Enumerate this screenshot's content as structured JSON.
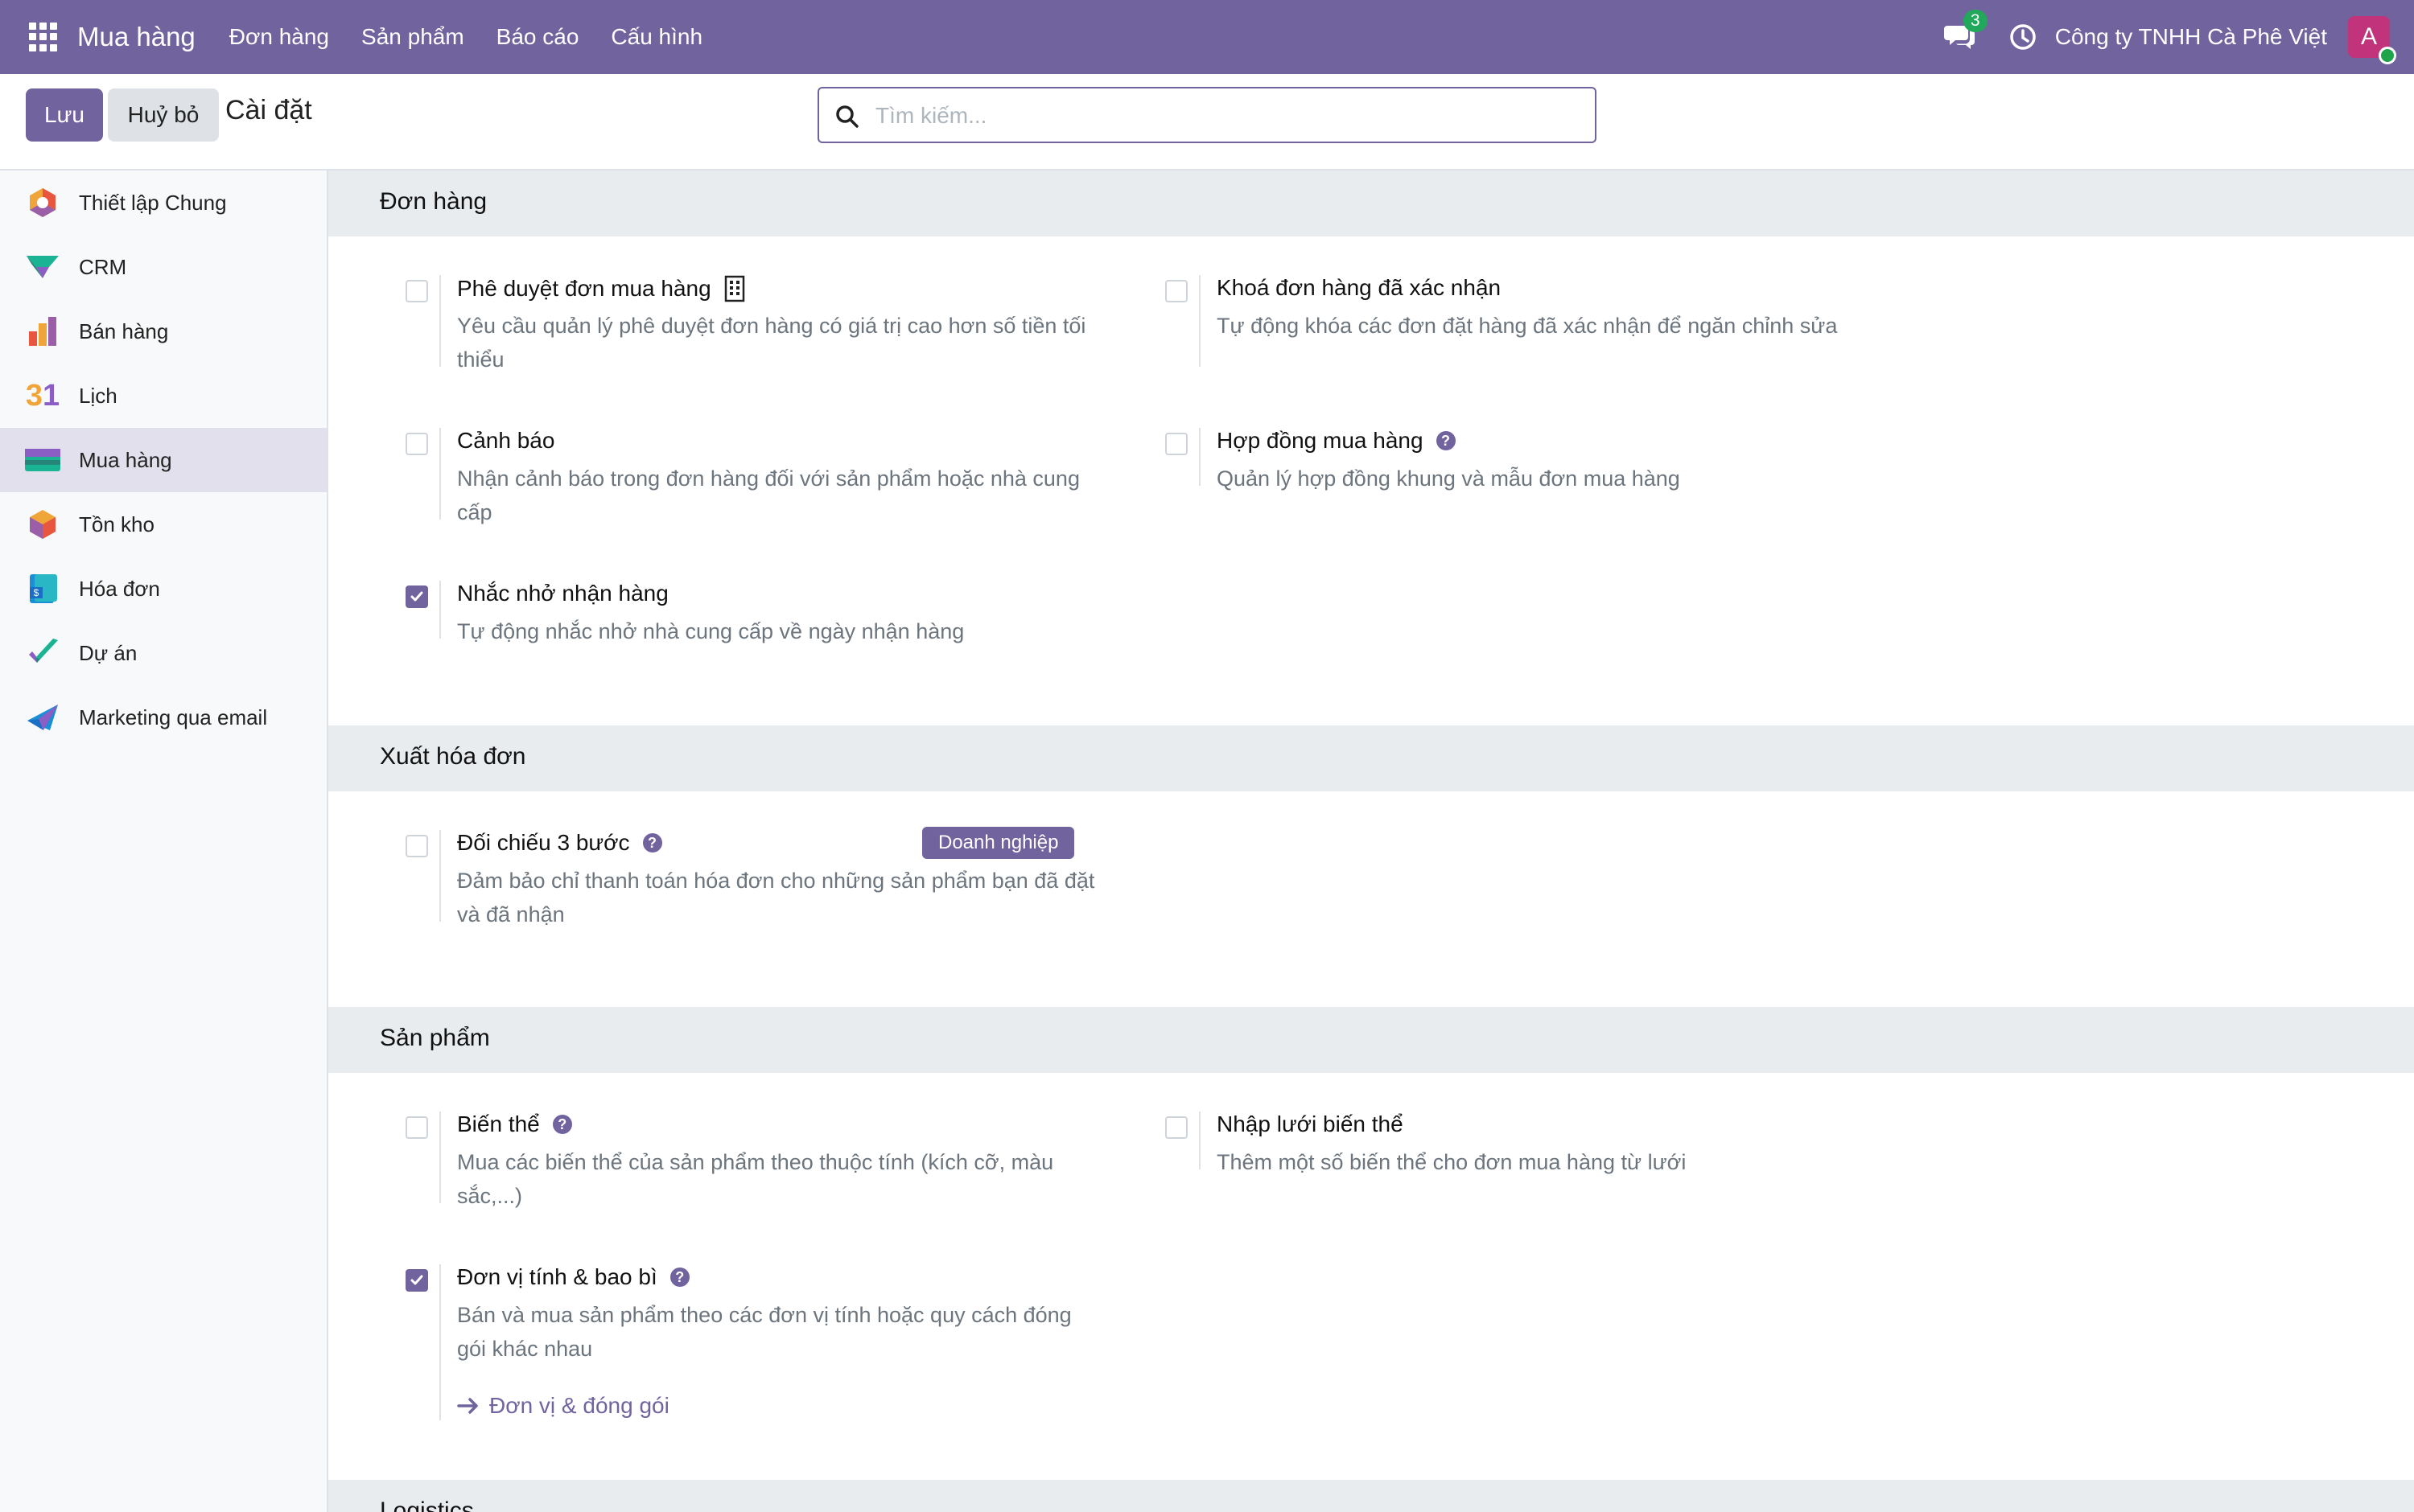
{
  "navbar": {
    "brand": "Mua hàng",
    "menu": [
      "Đơn hàng",
      "Sản phẩm",
      "Báo cáo",
      "Cấu hình"
    ],
    "messages_count": "3",
    "company": "Công ty TNHH Cà Phê Việt",
    "avatar_letter": "A"
  },
  "control": {
    "save_label": "Lưu",
    "discard_label": "Huỷ bỏ",
    "breadcrumb": "Cài đặt",
    "search_placeholder": "Tìm kiếm..."
  },
  "sidebar": {
    "items": [
      {
        "label": "Thiết lập Chung",
        "icon": "settings-app-icon",
        "active": false
      },
      {
        "label": "CRM",
        "icon": "crm-app-icon",
        "active": false
      },
      {
        "label": "Bán hàng",
        "icon": "sales-app-icon",
        "active": false
      },
      {
        "label": "Lịch",
        "icon": "calendar-app-icon",
        "calendar_number": "31",
        "active": false
      },
      {
        "label": "Mua hàng",
        "icon": "purchase-app-icon",
        "active": true
      },
      {
        "label": "Tồn kho",
        "icon": "inventory-app-icon",
        "active": false
      },
      {
        "label": "Hóa đơn",
        "icon": "invoicing-app-icon",
        "active": false
      },
      {
        "label": "Dự án",
        "icon": "project-app-icon",
        "active": false
      },
      {
        "label": "Marketing qua email",
        "icon": "email-marketing-app-icon",
        "active": false
      }
    ]
  },
  "sections": {
    "orders": {
      "title": "Đơn hàng",
      "settings": [
        {
          "title": "Phê duyệt đơn mua hàng",
          "desc": "Yêu cầu quản lý phê duyệt đơn hàng có giá trị cao hơn số tiền tối thiểu",
          "checked": false,
          "icon": "company-building-icon"
        },
        {
          "title": "Khoá đơn hàng đã xác nhận",
          "desc": "Tự động khóa các đơn đặt hàng đã xác nhận để ngăn chỉnh sửa",
          "checked": false
        },
        {
          "title": "Cảnh báo",
          "desc": "Nhận cảnh báo trong đơn hàng đối với sản phẩm hoặc nhà cung cấp",
          "checked": false
        },
        {
          "title": "Hợp đồng mua hàng",
          "desc": "Quản lý hợp đồng khung và mẫu đơn mua hàng",
          "checked": false,
          "help": true
        },
        {
          "title": "Nhắc nhở nhận hàng",
          "desc": "Tự động nhắc nhở nhà cung cấp về ngày nhận hàng",
          "checked": true
        }
      ]
    },
    "invoicing": {
      "title": "Xuất hóa đơn",
      "settings": [
        {
          "title": "Đối chiếu 3 bước",
          "desc": "Đảm bảo chỉ thanh toán hóa đơn cho những sản phẩm bạn đã đặt và đã nhận",
          "checked": false,
          "help": true,
          "badge": "Doanh nghiệp"
        }
      ]
    },
    "products": {
      "title": "Sản phẩm",
      "settings": [
        {
          "title": "Biến thể",
          "desc": "Mua các biến thể của sản phẩm theo thuộc tính (kích cỡ, màu sắc,...)",
          "checked": false,
          "help": true
        },
        {
          "title": "Nhập lưới biến thể",
          "desc": "Thêm một số biến thể cho đơn mua hàng từ lưới",
          "checked": false
        },
        {
          "title": "Đơn vị tính & bao bì",
          "desc": "Bán và mua sản phẩm theo các đơn vị tính hoặc quy cách đóng gói khác nhau",
          "checked": true,
          "help": true,
          "link": "Đơn vị & đóng gói"
        }
      ]
    },
    "logistics": {
      "title": "Logistics"
    }
  },
  "colors": {
    "brand": "#71639e",
    "navbar": "#71639e",
    "badge_green": "#21a85b",
    "section_bg": "#e9ecef",
    "muted_text": "#6c757d"
  }
}
